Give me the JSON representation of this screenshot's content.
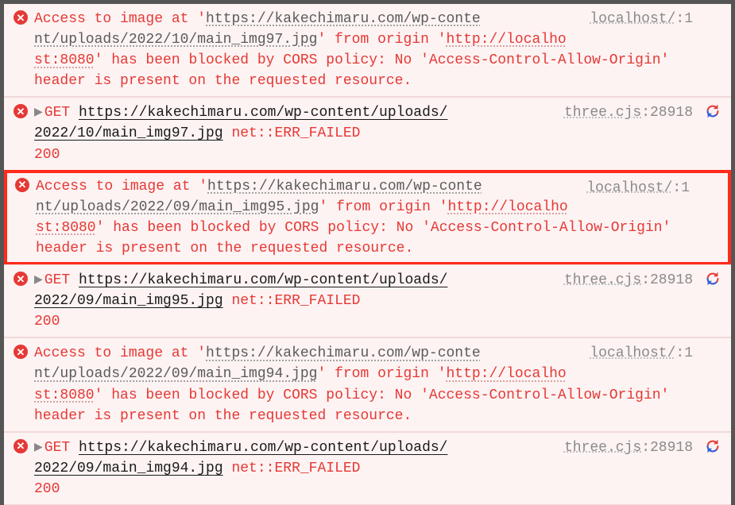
{
  "entries": [
    {
      "type": "cors",
      "highlighted": false,
      "text_prefix": "Access to image at '",
      "image_url": "https://kakechimaru.com/wp-content/uploads/2022/10/main_img97.jpg",
      "text_mid1": "' from origin '",
      "origin_url": "http://localhost:8080",
      "text_suffix": "' has been blocked by CORS policy: No 'Access-Control-Allow-Origin' header is present on the requested resource.",
      "source_file": "localhost/",
      "source_line": ":1"
    },
    {
      "type": "net",
      "highlighted": false,
      "method": "GET",
      "url": "https://kakechimaru.com/wp-content/uploads/2022/10/main_img97.jpg",
      "err": "net::ERR_FAILED 200",
      "source_file": "three.cjs",
      "source_line": ":28918"
    },
    {
      "type": "cors",
      "highlighted": true,
      "text_prefix": "Access to image at '",
      "image_url": "https://kakechimaru.com/wp-content/uploads/2022/09/main_img95.jpg",
      "text_mid1": "' from origin '",
      "origin_url": "http://localhost:8080",
      "text_suffix": "' has been blocked by CORS policy: No 'Access-Control-Allow-Origin' header is present on the requested resource.",
      "source_file": "localhost/",
      "source_line": ":1"
    },
    {
      "type": "net",
      "highlighted": false,
      "method": "GET",
      "url": "https://kakechimaru.com/wp-content/uploads/2022/09/main_img95.jpg",
      "err": "net::ERR_FAILED 200",
      "source_file": "three.cjs",
      "source_line": ":28918"
    },
    {
      "type": "cors",
      "highlighted": false,
      "text_prefix": "Access to image at '",
      "image_url": "https://kakechimaru.com/wp-content/uploads/2022/09/main_img94.jpg",
      "text_mid1": "' from origin '",
      "origin_url": "http://localhost:8080",
      "text_suffix": "' has been blocked by CORS policy: No 'Access-Control-Allow-Origin' header is present on the requested resource.",
      "source_file": "localhost/",
      "source_line": ":1"
    },
    {
      "type": "net",
      "highlighted": false,
      "method": "GET",
      "url": "https://kakechimaru.com/wp-content/uploads/2022/09/main_img94.jpg",
      "err": "net::ERR_FAILED 200",
      "source_file": "three.cjs",
      "source_line": ":28918"
    }
  ]
}
